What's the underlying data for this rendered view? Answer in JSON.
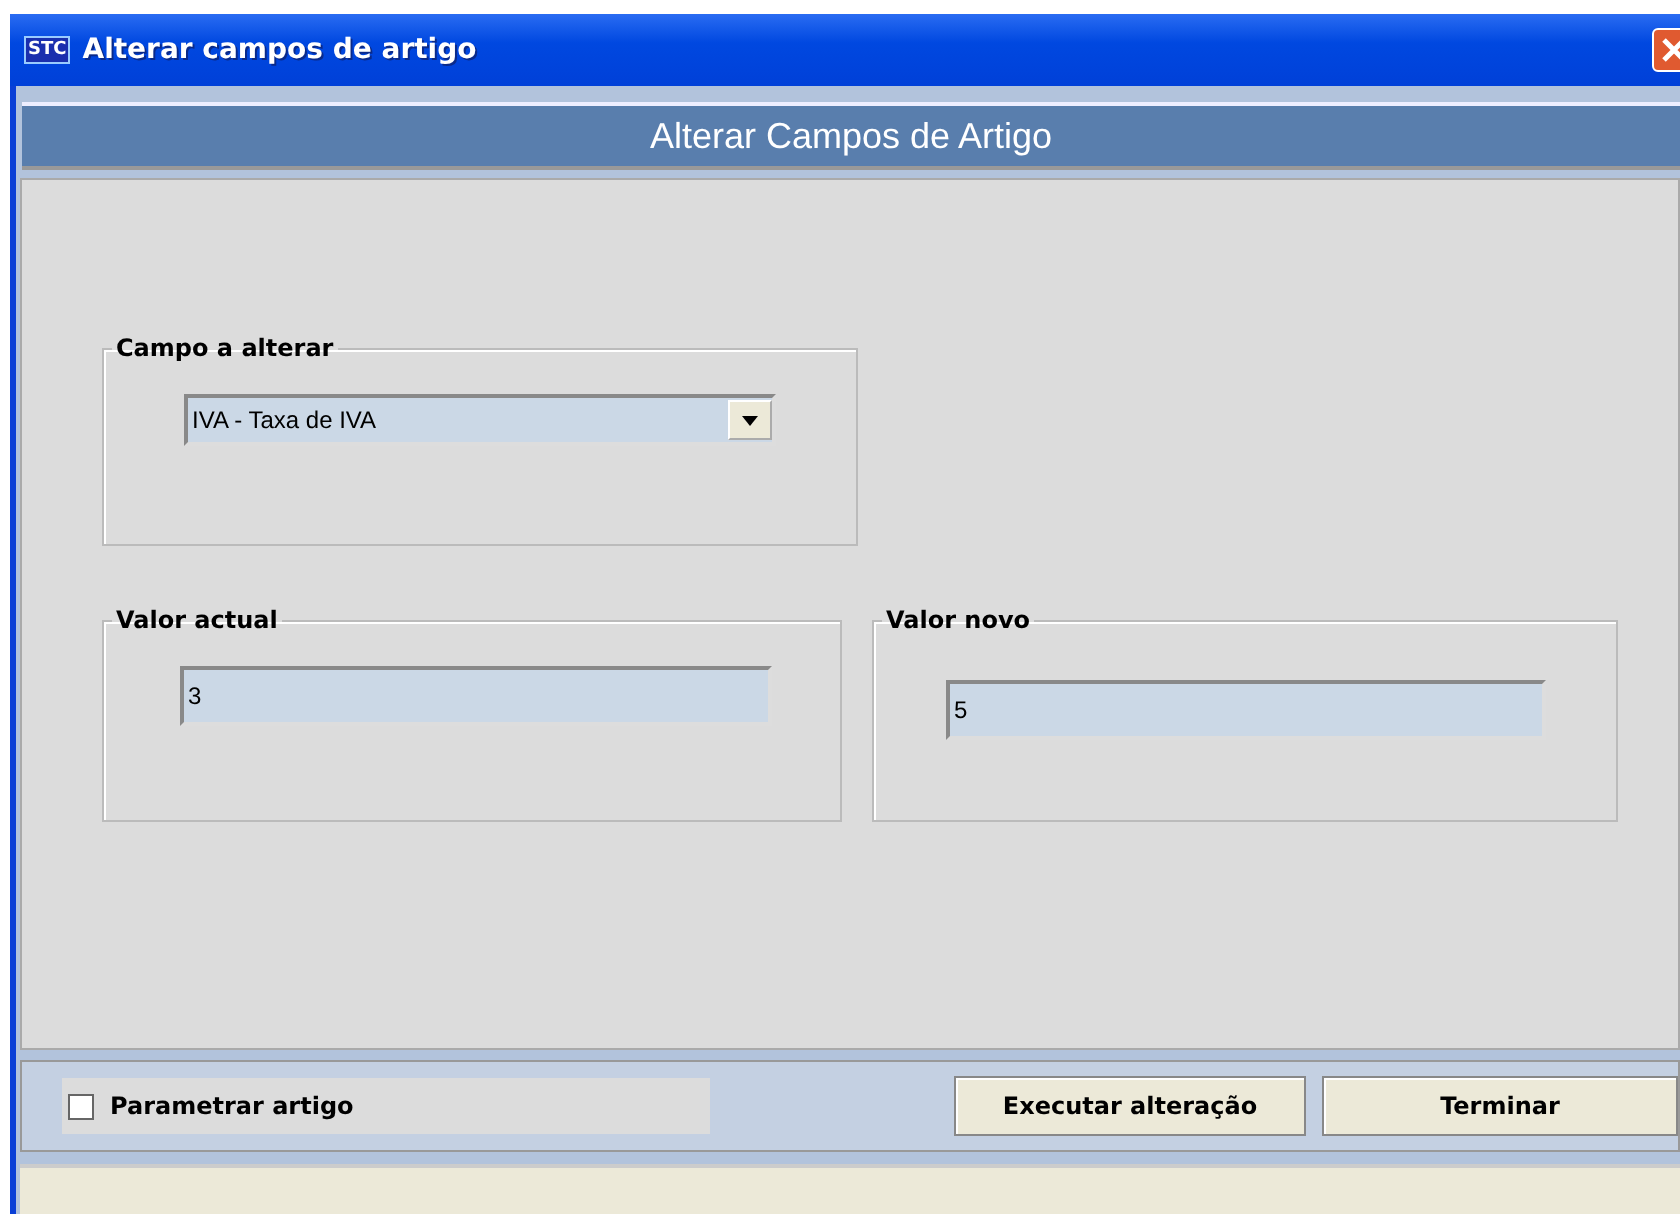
{
  "window": {
    "title": "Alterar campos de artigo",
    "app_badge": "STC"
  },
  "header": "Alterar Campos de Artigo",
  "field_group": {
    "legend": "Campo a alterar",
    "value": "IVA - Taxa de IVA"
  },
  "current_value": {
    "legend": "Valor actual",
    "value": "3"
  },
  "new_value": {
    "legend": "Valor novo",
    "value": "5"
  },
  "option": {
    "label": "Parametrar artigo",
    "checked": false
  },
  "buttons": [
    "Executar alteração",
    "Terminar"
  ]
}
